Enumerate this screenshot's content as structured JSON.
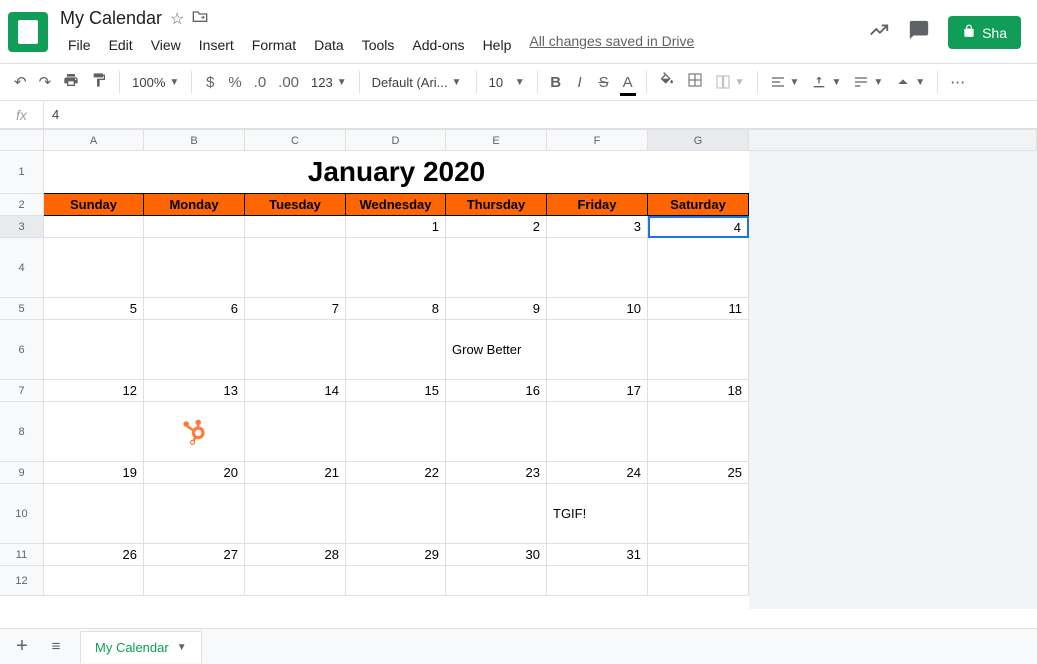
{
  "doc": {
    "title": "My Calendar"
  },
  "menu": {
    "file": "File",
    "edit": "Edit",
    "view": "View",
    "insert": "Insert",
    "format": "Format",
    "data": "Data",
    "tools": "Tools",
    "addons": "Add-ons",
    "help": "Help",
    "saved": "All changes saved in Drive"
  },
  "share": {
    "label": "Sha"
  },
  "toolbar": {
    "zoom": "100%",
    "font": "Default (Ari...",
    "fontsize": "10"
  },
  "fx": {
    "value": "4"
  },
  "columns": [
    "A",
    "B",
    "C",
    "D",
    "E",
    "F",
    "G"
  ],
  "rows": [
    "1",
    "2",
    "3",
    "4",
    "5",
    "6",
    "7",
    "8",
    "9",
    "10",
    "11",
    "12"
  ],
  "month_title": "January 2020",
  "dayheads": [
    "Sunday",
    "Monday",
    "Tuesday",
    "Wednesday",
    "Thursday",
    "Friday",
    "Saturday"
  ],
  "dates": {
    "w1": [
      "",
      "",
      "",
      "1",
      "2",
      "3",
      "4"
    ],
    "w2": [
      "5",
      "6",
      "7",
      "8",
      "9",
      "10",
      "11"
    ],
    "w3": [
      "12",
      "13",
      "14",
      "15",
      "16",
      "17",
      "18"
    ],
    "w4": [
      "19",
      "20",
      "21",
      "22",
      "23",
      "24",
      "25"
    ],
    "w5": [
      "26",
      "27",
      "28",
      "29",
      "30",
      "31",
      ""
    ]
  },
  "contents": {
    "grow": "Grow Better",
    "tgif": "TGIF!"
  },
  "tab": {
    "name": "My Calendar"
  }
}
